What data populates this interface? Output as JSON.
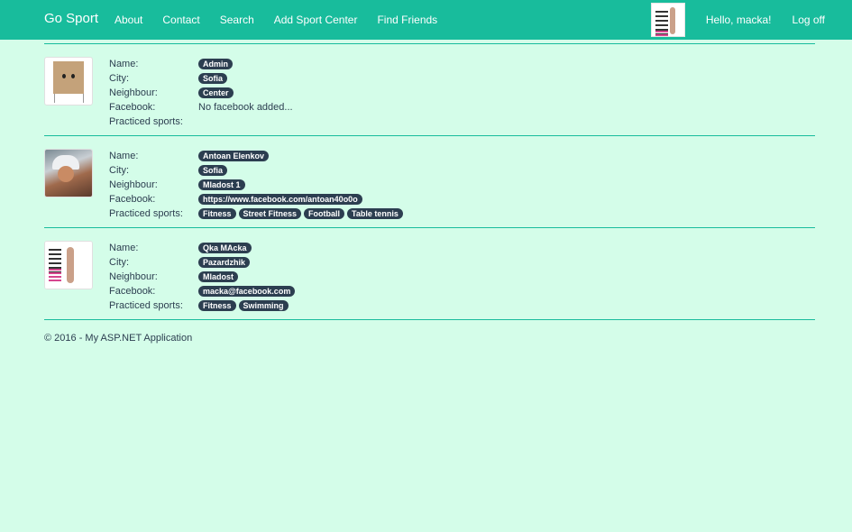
{
  "navbar": {
    "brand": "Go Sport",
    "links": [
      "About",
      "Contact",
      "Search",
      "Add Sport Center",
      "Find Friends"
    ],
    "greeting": "Hello, macka!",
    "logoff": "Log off"
  },
  "labels": {
    "name": "Name:",
    "city": "City:",
    "neighbour": "Neighbour:",
    "facebook": "Facebook:",
    "sports": "Practiced sports:"
  },
  "users": [
    {
      "name": "Admin",
      "city": "Sofia",
      "neighbour": "Center",
      "facebook": "No facebook added...",
      "facebook_is_badge": false,
      "sports": []
    },
    {
      "name": "Antoan Elenkov",
      "city": "Sofia",
      "neighbour": "Mladost 1",
      "facebook": "https://www.facebook.com/antoan40o0o",
      "facebook_is_badge": true,
      "sports": [
        "Fitness",
        "Street Fitness",
        "Football",
        "Table tennis"
      ]
    },
    {
      "name": "Qka MAcka",
      "city": "Pazardzhik",
      "neighbour": "Mladost",
      "facebook": "macka@facebook.com",
      "facebook_is_badge": true,
      "sports": [
        "Fitness",
        "Swimming"
      ]
    }
  ],
  "footer": "© 2016 - My ASP.NET Application"
}
